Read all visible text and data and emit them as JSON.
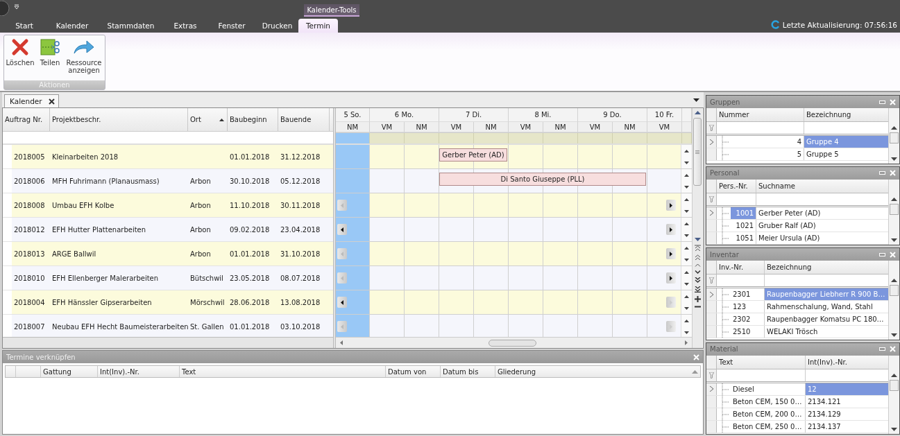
{
  "ribbon": {
    "context_group": "Kalender-Tools",
    "tabs": [
      {
        "label": "Start",
        "selected": false
      },
      {
        "label": "Kalender",
        "selected": false
      },
      {
        "label": "Stammdaten",
        "selected": false
      },
      {
        "label": "Extras",
        "selected": false
      },
      {
        "label": "Fenster",
        "selected": false
      },
      {
        "label": "Drucken",
        "selected": false
      },
      {
        "label": "Termin",
        "selected": true
      }
    ],
    "status": "Letzte Aktualisierung: 07:56:16",
    "groups": [
      {
        "title": "Aktionen",
        "buttons": [
          {
            "kind": "delete",
            "label": "Löschen"
          },
          {
            "kind": "split",
            "label": "Teilen"
          },
          {
            "kind": "show",
            "label": "Ressource anzeigen"
          }
        ]
      }
    ]
  },
  "document_tabs": [
    {
      "label": "Kalender",
      "selected": true
    }
  ],
  "table": {
    "columns": [
      {
        "label": "Auftrag Nr.",
        "sorted": false
      },
      {
        "label": "Projektbeschr.",
        "sorted": false
      },
      {
        "label": "Ort",
        "sorted": true
      },
      {
        "label": "Baubeginn",
        "sorted": false
      },
      {
        "label": "Bauende",
        "sorted": false
      }
    ],
    "rows": [
      {
        "cells": [
          "2018005",
          "Kleinarbeiten 2018",
          "",
          "01.01.2018",
          "31.12.2018"
        ]
      },
      {
        "cells": [
          "2018006",
          "MFH Fuhrimann (Planausmass)",
          "Arbon",
          "30.10.2018",
          "05.12.2018"
        ]
      },
      {
        "cells": [
          "2018008",
          "Umbau EFH Kolbe",
          "Arbon",
          "11.10.2018",
          "30.11.2018"
        ]
      },
      {
        "cells": [
          "2018012",
          "EFH Hutter Plattenarbeiten",
          "Arbon",
          "09.02.2018",
          "23.04.2018"
        ]
      },
      {
        "cells": [
          "2018013",
          "ARGE Ballwil",
          "Arbon",
          "01.01.2018",
          "31.10.2018"
        ]
      },
      {
        "cells": [
          "2018010",
          "EFH Ellenberger Malerarbeiten",
          "Bütschwil",
          "23.05.2018",
          "08.07.2018"
        ]
      },
      {
        "cells": [
          "2018004",
          "EFH Hänssler Gipserarbeiten",
          "Mörschwil",
          "28.06.2018",
          "13.08.2018"
        ]
      },
      {
        "cells": [
          "2018007",
          "Neubau EFH Hecht Baumeisterarbeiten",
          "St. Gallen",
          "01.01.2018",
          "03.10.2018"
        ]
      }
    ]
  },
  "calendar": {
    "days": [
      {
        "label": "5 So.",
        "halves": [
          "NM"
        ]
      },
      {
        "label": "6 Mo.",
        "halves": [
          "VM",
          "NM"
        ]
      },
      {
        "label": "7 Di.",
        "halves": [
          "VM",
          "NM"
        ]
      },
      {
        "label": "8 Mi.",
        "halves": [
          "VM",
          "NM"
        ]
      },
      {
        "label": "9 Do.",
        "halves": [
          "VM",
          "NM"
        ]
      },
      {
        "label": "10 Fr.",
        "halves": [
          "VM"
        ]
      }
    ],
    "rows": [
      {
        "appointments": [
          {
            "label": "Gerber Peter (AD)"
          }
        ]
      },
      {
        "appointments": [
          {
            "label": "Di Santo Giuseppe (PLL)"
          }
        ]
      },
      {
        "prev": {
          "enabled": false
        },
        "next": {
          "enabled": true
        }
      },
      {
        "prev": {
          "enabled": true
        },
        "next": {
          "enabled": true
        }
      },
      {
        "prev": {
          "enabled": false
        },
        "next": {
          "enabled": true
        }
      },
      {
        "prev": {
          "enabled": false
        },
        "next": {
          "enabled": true
        }
      },
      {
        "prev": {
          "enabled": true
        },
        "next": {
          "enabled": false
        }
      },
      {
        "prev": {
          "enabled": false
        },
        "next": {
          "enabled": false
        }
      }
    ]
  },
  "panels": [
    {
      "title": "Gruppen",
      "columns": [
        "Nummer",
        "Bezeichnung"
      ],
      "rows": [
        {
          "current": true,
          "cells": [
            {
              "text": "4",
              "selected": false
            },
            {
              "text": "Gruppe 4",
              "selected": true
            }
          ]
        },
        {
          "current": false,
          "cells": [
            {
              "text": "5",
              "selected": false
            },
            {
              "text": "Gruppe 5",
              "selected": false
            }
          ]
        }
      ]
    },
    {
      "title": "Personal",
      "columns": [
        "Pers.-Nr.",
        "Suchname"
      ],
      "rows": [
        {
          "current": true,
          "cells": [
            {
              "text": "1001",
              "selected": true
            },
            {
              "text": "Gerber Peter (AD)",
              "selected": false
            }
          ]
        },
        {
          "current": false,
          "cells": [
            {
              "text": "1021",
              "selected": false
            },
            {
              "text": "Gruber Ralf (AD)",
              "selected": false
            }
          ]
        },
        {
          "current": false,
          "cells": [
            {
              "text": "1051",
              "selected": false
            },
            {
              "text": "Meier Ursula (AD)",
              "selected": false
            }
          ]
        }
      ]
    },
    {
      "title": "Inventar",
      "columns": [
        "Inv.-Nr.",
        "Bezeichnung"
      ],
      "rows": [
        {
          "current": true,
          "cells": [
            {
              "text": "2301",
              "selected": false
            },
            {
              "text": "Raupenbagger Liebherr R 900 B…",
              "selected": true
            }
          ]
        },
        {
          "current": false,
          "cells": [
            {
              "text": "123",
              "selected": false
            },
            {
              "text": "Rahmenschalung, Wand, Stahl",
              "selected": false
            }
          ]
        },
        {
          "current": false,
          "cells": [
            {
              "text": "2302",
              "selected": false
            },
            {
              "text": "Raupenbagger Komatsu PC 180…",
              "selected": false
            }
          ]
        },
        {
          "current": false,
          "cells": [
            {
              "text": "2510",
              "selected": false
            },
            {
              "text": "WELAKI Trösch",
              "selected": false
            }
          ]
        }
      ]
    },
    {
      "title": "Material",
      "columns": [
        "Text",
        "Int(Inv).-Nr."
      ],
      "rows": [
        {
          "current": true,
          "cells": [
            {
              "text": "Diesel",
              "selected": false
            },
            {
              "text": "12",
              "selected": true
            }
          ]
        },
        {
          "current": false,
          "cells": [
            {
              "text": "Beton CEM, 150  0…",
              "selected": false
            },
            {
              "text": "2134.121",
              "selected": false
            }
          ]
        },
        {
          "current": false,
          "cells": [
            {
              "text": "Beton CEM, 200  0…",
              "selected": false
            },
            {
              "text": "2134.129",
              "selected": false
            }
          ]
        },
        {
          "current": false,
          "cells": [
            {
              "text": "Beton CEM, 250  0…",
              "selected": false
            },
            {
              "text": "2134.137",
              "selected": false
            }
          ]
        }
      ]
    }
  ],
  "links_panel": {
    "title": "Termine verknüpfen",
    "columns": [
      {
        "label": "Gattung",
        "sorted": false
      },
      {
        "label": "Int(Inv).-Nr.",
        "sorted": false
      },
      {
        "label": "Text",
        "sorted": false
      },
      {
        "label": "Datum von",
        "sorted": false
      },
      {
        "label": "Datum bis",
        "sorted": false
      },
      {
        "label": "Gliederung",
        "sorted": true
      }
    ]
  }
}
